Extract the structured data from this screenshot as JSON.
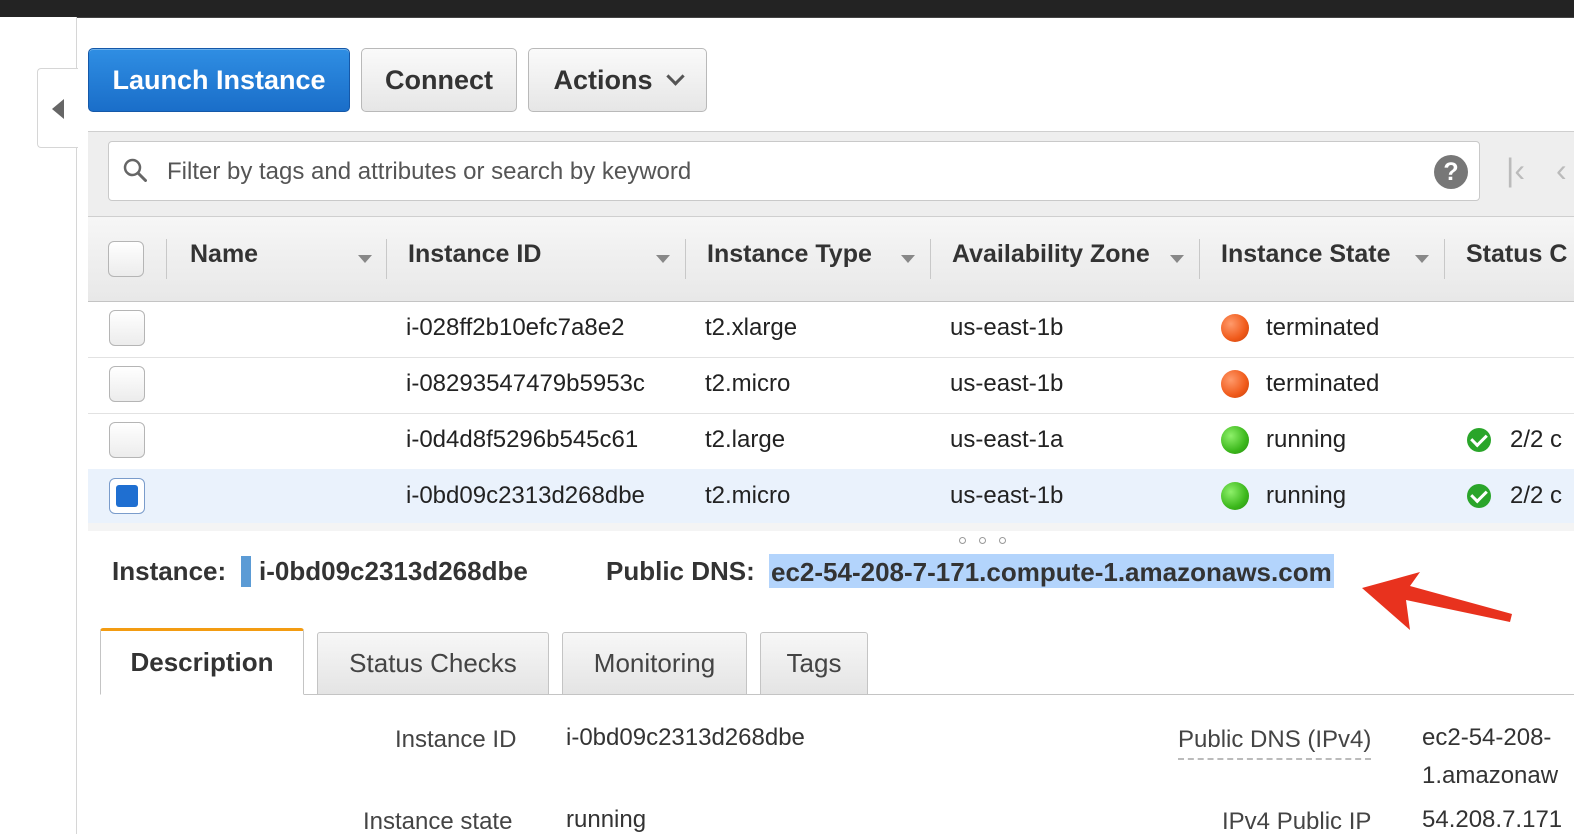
{
  "toolbar": {
    "launch_label": "Launch Instance",
    "connect_label": "Connect",
    "actions_label": "Actions"
  },
  "search": {
    "placeholder": "Filter by tags and attributes or search by keyword",
    "help": "?"
  },
  "table": {
    "columns": [
      "Name",
      "Instance ID",
      "Instance Type",
      "Availability Zone",
      "Instance State",
      "Status C"
    ],
    "rows": [
      {
        "name": "",
        "id": "i-028ff2b10efc7a8e2",
        "type": "t2.xlarge",
        "zone": "us-east-1b",
        "state": "terminated",
        "state_color": "#f05a1a",
        "status": "",
        "checked": false
      },
      {
        "name": "",
        "id": "i-08293547479b5953c",
        "type": "t2.micro",
        "zone": "us-east-1b",
        "state": "terminated",
        "state_color": "#f05a1a",
        "status": "",
        "checked": false
      },
      {
        "name": "",
        "id": "i-0d4d8f5296b545c61",
        "type": "t2.large",
        "zone": "us-east-1a",
        "state": "running",
        "state_color": "#3cb81c",
        "status": "2/2 c",
        "checked": false
      },
      {
        "name": "",
        "id": "i-0bd09c2313d268dbe",
        "type": "t2.micro",
        "zone": "us-east-1b",
        "state": "running",
        "state_color": "#3cb81c",
        "status": "2/2 c",
        "checked": true
      }
    ]
  },
  "summary": {
    "instance_label": "Instance:",
    "instance_id": "i-0bd09c2313d268dbe",
    "dns_label": "Public DNS:",
    "dns_value": "ec2-54-208-7-171.compute-1.amazonaws.com"
  },
  "tabs": [
    "Description",
    "Status Checks",
    "Monitoring",
    "Tags"
  ],
  "details": {
    "left": [
      {
        "label": "Instance ID",
        "value": "i-0bd09c2313d268dbe"
      },
      {
        "label": "Instance state",
        "value": "running"
      }
    ],
    "right": [
      {
        "label": "Public DNS (IPv4)",
        "value_line1": "ec2-54-208-",
        "value_line2": "1.amazonaw"
      },
      {
        "label": "IPv4 Public IP",
        "value": "54.208.7.171"
      }
    ]
  },
  "colors": {
    "primary": "#1a6ec9",
    "highlight": "#b3d4fc",
    "active_tab_accent": "#f39c12",
    "annotation_arrow": "#e8321e"
  }
}
